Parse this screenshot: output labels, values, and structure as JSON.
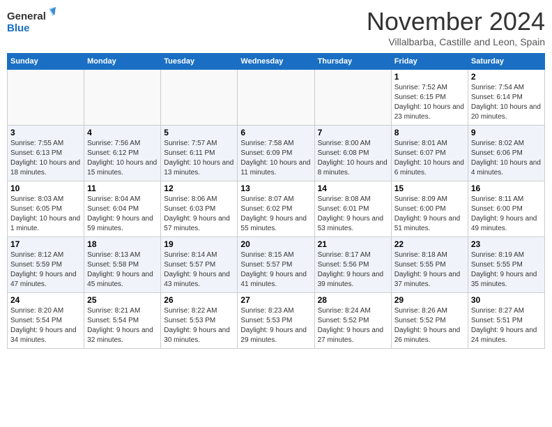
{
  "header": {
    "logo_line1": "General",
    "logo_line2": "Blue",
    "month": "November 2024",
    "location": "Villalbarba, Castille and Leon, Spain"
  },
  "days_of_week": [
    "Sunday",
    "Monday",
    "Tuesday",
    "Wednesday",
    "Thursday",
    "Friday",
    "Saturday"
  ],
  "weeks": [
    [
      {
        "day": "",
        "info": ""
      },
      {
        "day": "",
        "info": ""
      },
      {
        "day": "",
        "info": ""
      },
      {
        "day": "",
        "info": ""
      },
      {
        "day": "",
        "info": ""
      },
      {
        "day": "1",
        "info": "Sunrise: 7:52 AM\nSunset: 6:15 PM\nDaylight: 10 hours and 23 minutes."
      },
      {
        "day": "2",
        "info": "Sunrise: 7:54 AM\nSunset: 6:14 PM\nDaylight: 10 hours and 20 minutes."
      }
    ],
    [
      {
        "day": "3",
        "info": "Sunrise: 7:55 AM\nSunset: 6:13 PM\nDaylight: 10 hours and 18 minutes."
      },
      {
        "day": "4",
        "info": "Sunrise: 7:56 AM\nSunset: 6:12 PM\nDaylight: 10 hours and 15 minutes."
      },
      {
        "day": "5",
        "info": "Sunrise: 7:57 AM\nSunset: 6:11 PM\nDaylight: 10 hours and 13 minutes."
      },
      {
        "day": "6",
        "info": "Sunrise: 7:58 AM\nSunset: 6:09 PM\nDaylight: 10 hours and 11 minutes."
      },
      {
        "day": "7",
        "info": "Sunrise: 8:00 AM\nSunset: 6:08 PM\nDaylight: 10 hours and 8 minutes."
      },
      {
        "day": "8",
        "info": "Sunrise: 8:01 AM\nSunset: 6:07 PM\nDaylight: 10 hours and 6 minutes."
      },
      {
        "day": "9",
        "info": "Sunrise: 8:02 AM\nSunset: 6:06 PM\nDaylight: 10 hours and 4 minutes."
      }
    ],
    [
      {
        "day": "10",
        "info": "Sunrise: 8:03 AM\nSunset: 6:05 PM\nDaylight: 10 hours and 1 minute."
      },
      {
        "day": "11",
        "info": "Sunrise: 8:04 AM\nSunset: 6:04 PM\nDaylight: 9 hours and 59 minutes."
      },
      {
        "day": "12",
        "info": "Sunrise: 8:06 AM\nSunset: 6:03 PM\nDaylight: 9 hours and 57 minutes."
      },
      {
        "day": "13",
        "info": "Sunrise: 8:07 AM\nSunset: 6:02 PM\nDaylight: 9 hours and 55 minutes."
      },
      {
        "day": "14",
        "info": "Sunrise: 8:08 AM\nSunset: 6:01 PM\nDaylight: 9 hours and 53 minutes."
      },
      {
        "day": "15",
        "info": "Sunrise: 8:09 AM\nSunset: 6:00 PM\nDaylight: 9 hours and 51 minutes."
      },
      {
        "day": "16",
        "info": "Sunrise: 8:11 AM\nSunset: 6:00 PM\nDaylight: 9 hours and 49 minutes."
      }
    ],
    [
      {
        "day": "17",
        "info": "Sunrise: 8:12 AM\nSunset: 5:59 PM\nDaylight: 9 hours and 47 minutes."
      },
      {
        "day": "18",
        "info": "Sunrise: 8:13 AM\nSunset: 5:58 PM\nDaylight: 9 hours and 45 minutes."
      },
      {
        "day": "19",
        "info": "Sunrise: 8:14 AM\nSunset: 5:57 PM\nDaylight: 9 hours and 43 minutes."
      },
      {
        "day": "20",
        "info": "Sunrise: 8:15 AM\nSunset: 5:57 PM\nDaylight: 9 hours and 41 minutes."
      },
      {
        "day": "21",
        "info": "Sunrise: 8:17 AM\nSunset: 5:56 PM\nDaylight: 9 hours and 39 minutes."
      },
      {
        "day": "22",
        "info": "Sunrise: 8:18 AM\nSunset: 5:55 PM\nDaylight: 9 hours and 37 minutes."
      },
      {
        "day": "23",
        "info": "Sunrise: 8:19 AM\nSunset: 5:55 PM\nDaylight: 9 hours and 35 minutes."
      }
    ],
    [
      {
        "day": "24",
        "info": "Sunrise: 8:20 AM\nSunset: 5:54 PM\nDaylight: 9 hours and 34 minutes."
      },
      {
        "day": "25",
        "info": "Sunrise: 8:21 AM\nSunset: 5:54 PM\nDaylight: 9 hours and 32 minutes."
      },
      {
        "day": "26",
        "info": "Sunrise: 8:22 AM\nSunset: 5:53 PM\nDaylight: 9 hours and 30 minutes."
      },
      {
        "day": "27",
        "info": "Sunrise: 8:23 AM\nSunset: 5:53 PM\nDaylight: 9 hours and 29 minutes."
      },
      {
        "day": "28",
        "info": "Sunrise: 8:24 AM\nSunset: 5:52 PM\nDaylight: 9 hours and 27 minutes."
      },
      {
        "day": "29",
        "info": "Sunrise: 8:26 AM\nSunset: 5:52 PM\nDaylight: 9 hours and 26 minutes."
      },
      {
        "day": "30",
        "info": "Sunrise: 8:27 AM\nSunset: 5:51 PM\nDaylight: 9 hours and 24 minutes."
      }
    ]
  ]
}
